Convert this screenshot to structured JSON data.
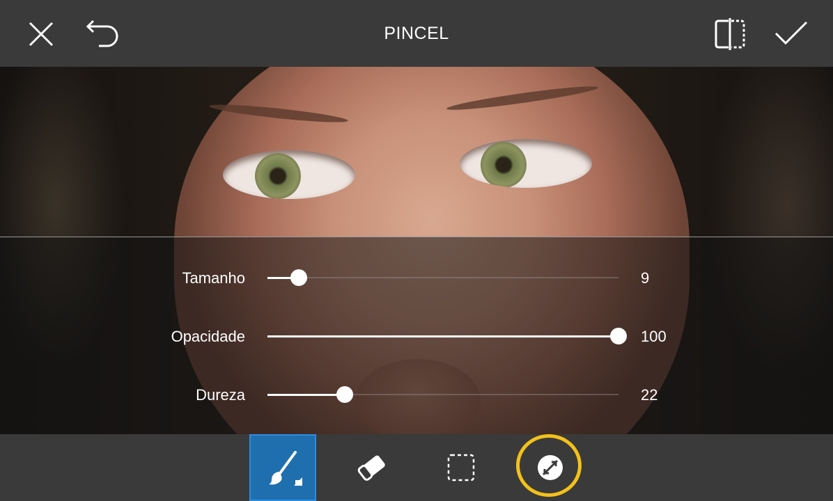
{
  "header": {
    "title": "PINCEL",
    "close_icon": "close-icon",
    "undo_icon": "undo-icon",
    "compare_icon": "compare-icon",
    "apply_icon": "check-icon"
  },
  "sliders": [
    {
      "label": "Tamanho",
      "value": "9",
      "fraction": 0.09
    },
    {
      "label": "Opacidade",
      "value": "100",
      "fraction": 1.0
    },
    {
      "label": "Dureza",
      "value": "22",
      "fraction": 0.22
    }
  ],
  "toolbar": {
    "tools": [
      {
        "name": "brush",
        "icon": "brush-icon",
        "active": true
      },
      {
        "name": "eraser",
        "icon": "eraser-icon",
        "active": false
      },
      {
        "name": "selection",
        "icon": "dashed-square-icon",
        "active": false
      },
      {
        "name": "invert",
        "icon": "invert-arrows-icon",
        "active": false,
        "highlighted": true
      }
    ]
  },
  "colors": {
    "bar_bg": "#3a3a3a",
    "active_tool": "#1f6fae",
    "highlight_ring": "#f3c11a",
    "slider_fill": "#ffffff"
  }
}
